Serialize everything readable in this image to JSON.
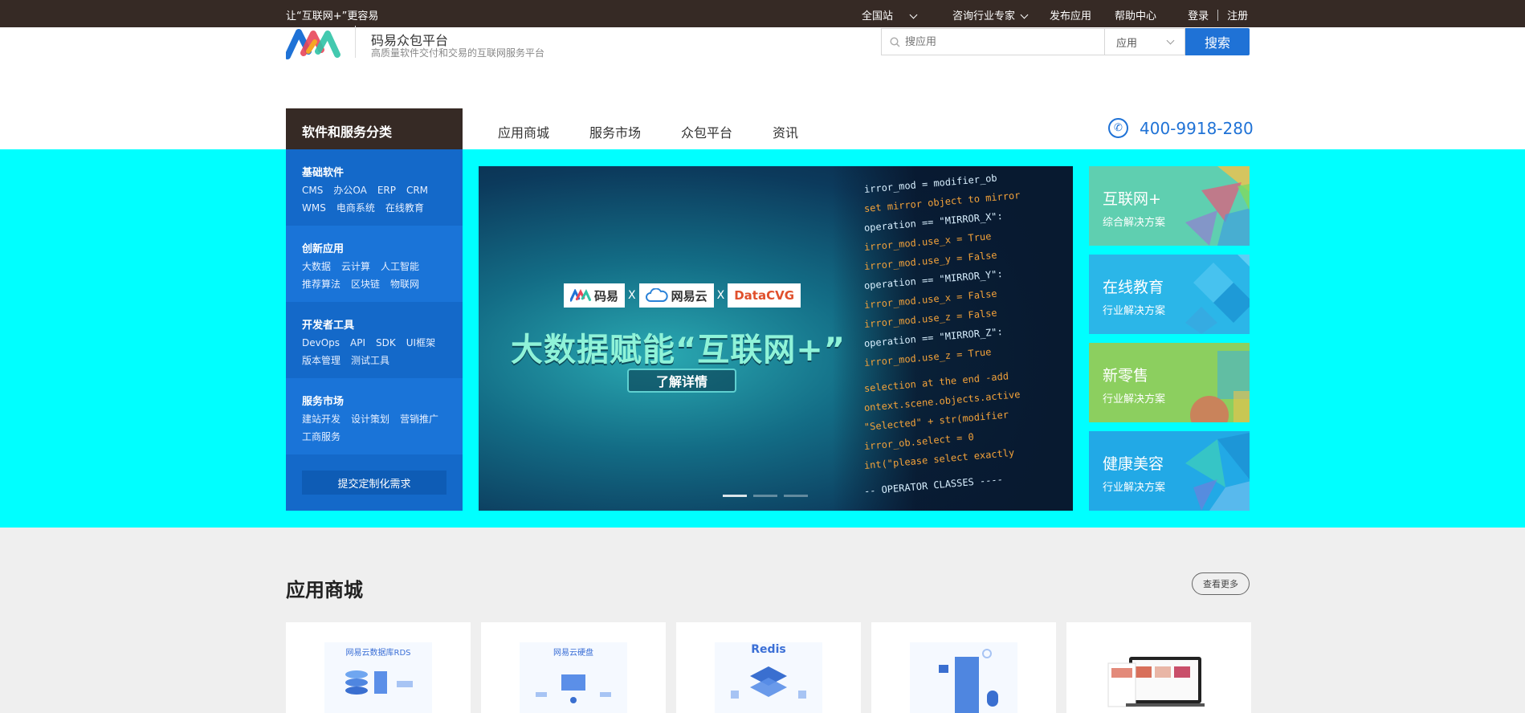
{
  "topbar": {
    "slogan": "让“互联网+”更容易",
    "station": "全国站",
    "consult": "咨询行业专家",
    "publish": "发布应用",
    "help": "帮助中心",
    "login": "登录",
    "register": "注册"
  },
  "brand": {
    "name": "码易众包平台",
    "tagline": "高质量软件交付和交易的互联网服务平台"
  },
  "search": {
    "placeholder": "搜应用",
    "category": "应用",
    "button": "搜索"
  },
  "nav": {
    "category_title": "软件和服务分类",
    "items": [
      "应用商城",
      "服务市场",
      "众包平台",
      "资讯"
    ],
    "phone": "400-9918-280"
  },
  "categories": [
    {
      "title": "基础软件",
      "rows": [
        [
          "CMS",
          "办公OA",
          "ERP",
          "CRM"
        ],
        [
          "WMS",
          "电商系统",
          "在线教育"
        ]
      ]
    },
    {
      "title": "创新应用",
      "rows": [
        [
          "大数据",
          "云计算",
          "人工智能"
        ],
        [
          "推荐算法",
          "区块链",
          "物联网"
        ]
      ]
    },
    {
      "title": "开发者工具",
      "rows": [
        [
          "DevOps",
          "API",
          "SDK",
          "UI框架"
        ],
        [
          "版本管理",
          "测试工具"
        ]
      ]
    },
    {
      "title": "服务市场",
      "rows": [
        [
          "建站开发",
          "设计策划",
          "营销推广"
        ],
        [
          "工商服务"
        ]
      ]
    }
  ],
  "custom_request": "提交定制化需求",
  "hero": {
    "partner_1": "码易",
    "partner_2": "网易云",
    "partner_3": "DataCVG",
    "x": "X",
    "headline": "大数据赋能“互联网+”",
    "button": "了解详情",
    "slides": 3,
    "active_slide": 1
  },
  "tiles": [
    {
      "title": "互联网+",
      "subtitle": "综合解决方案",
      "color": "#5fcfb0"
    },
    {
      "title": "在线教育",
      "subtitle": "行业解决方案",
      "color": "#2bb6e8"
    },
    {
      "title": "新零售",
      "subtitle": "行业解决方案",
      "color": "#8ccf5f"
    },
    {
      "title": "健康美容",
      "subtitle": "行业解决方案",
      "color": "#22a9e6"
    }
  ],
  "store": {
    "title": "应用商城",
    "more": "查看更多",
    "cards": [
      {
        "caption": "网易云数据库RDS"
      },
      {
        "caption": "网易云硬盘"
      },
      {
        "caption": "Redis"
      },
      {
        "caption": ""
      },
      {
        "caption": ""
      }
    ]
  },
  "colors": {
    "topbar": "#362a25",
    "accent": "#1f72d6",
    "banner_bg": "#00ffff",
    "category_bg": "#1469c9"
  }
}
